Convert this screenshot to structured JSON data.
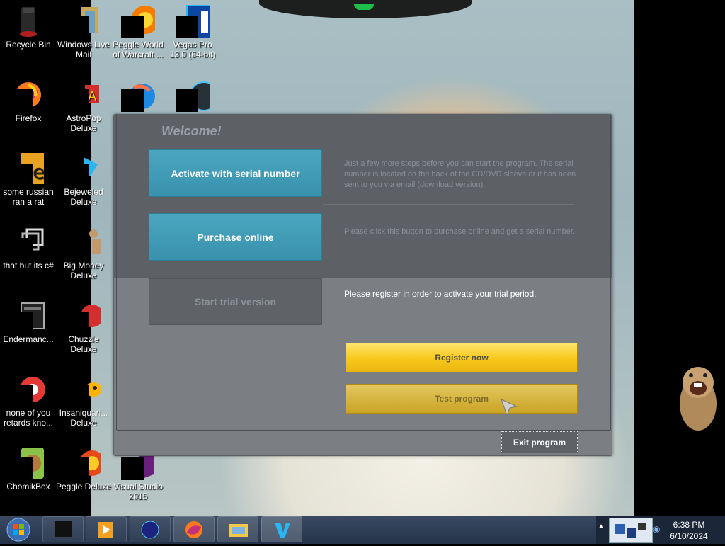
{
  "desktop": {
    "icons": [
      {
        "label": "Recycle Bin"
      },
      {
        "label": "Windows Live Mail"
      },
      {
        "label": "Peggle World of Warcraft ..."
      },
      {
        "label": "Vegas Pro 13.0 (64-bit)"
      },
      {
        "label": "Firefox"
      },
      {
        "label": "AstroPop Deluxe"
      },
      {
        "label": "some russian ran a rat"
      },
      {
        "label": "Bejeweled Deluxe"
      },
      {
        "label": "that but its c#"
      },
      {
        "label": "Big Money Deluxe"
      },
      {
        "label": "Endermanc..."
      },
      {
        "label": "Chuzzle Deluxe"
      },
      {
        "label": "none of you retards kno..."
      },
      {
        "label": "Insaniquari... Deluxe"
      },
      {
        "label": "ChomikBox"
      },
      {
        "label": "Peggle Deluxe"
      },
      {
        "label": "Visual Studio 2015"
      }
    ]
  },
  "dialog": {
    "welcome": "Welcome!",
    "activate_label": "Activate with serial number",
    "activate_desc": "Just a few more steps before you can start the program. The serial number is located on the back of the CD/DVD sleeve or it has been sent to you via email (download version).",
    "purchase_label": "Purchase online",
    "purchase_desc": "Please click this button to purchase online and get a serial number.",
    "trial_label": "Start trial version",
    "trial_desc": "Please register in order to activate your trial period.",
    "register_label": "Register now",
    "test_label": "Test program",
    "exit_label": "Exit program"
  },
  "taskbar": {
    "time": "6:38 PM",
    "date": "6/10/2024"
  },
  "colors": {
    "accent_blue": "#3a92ad",
    "accent_yellow": "#f7c81a"
  }
}
